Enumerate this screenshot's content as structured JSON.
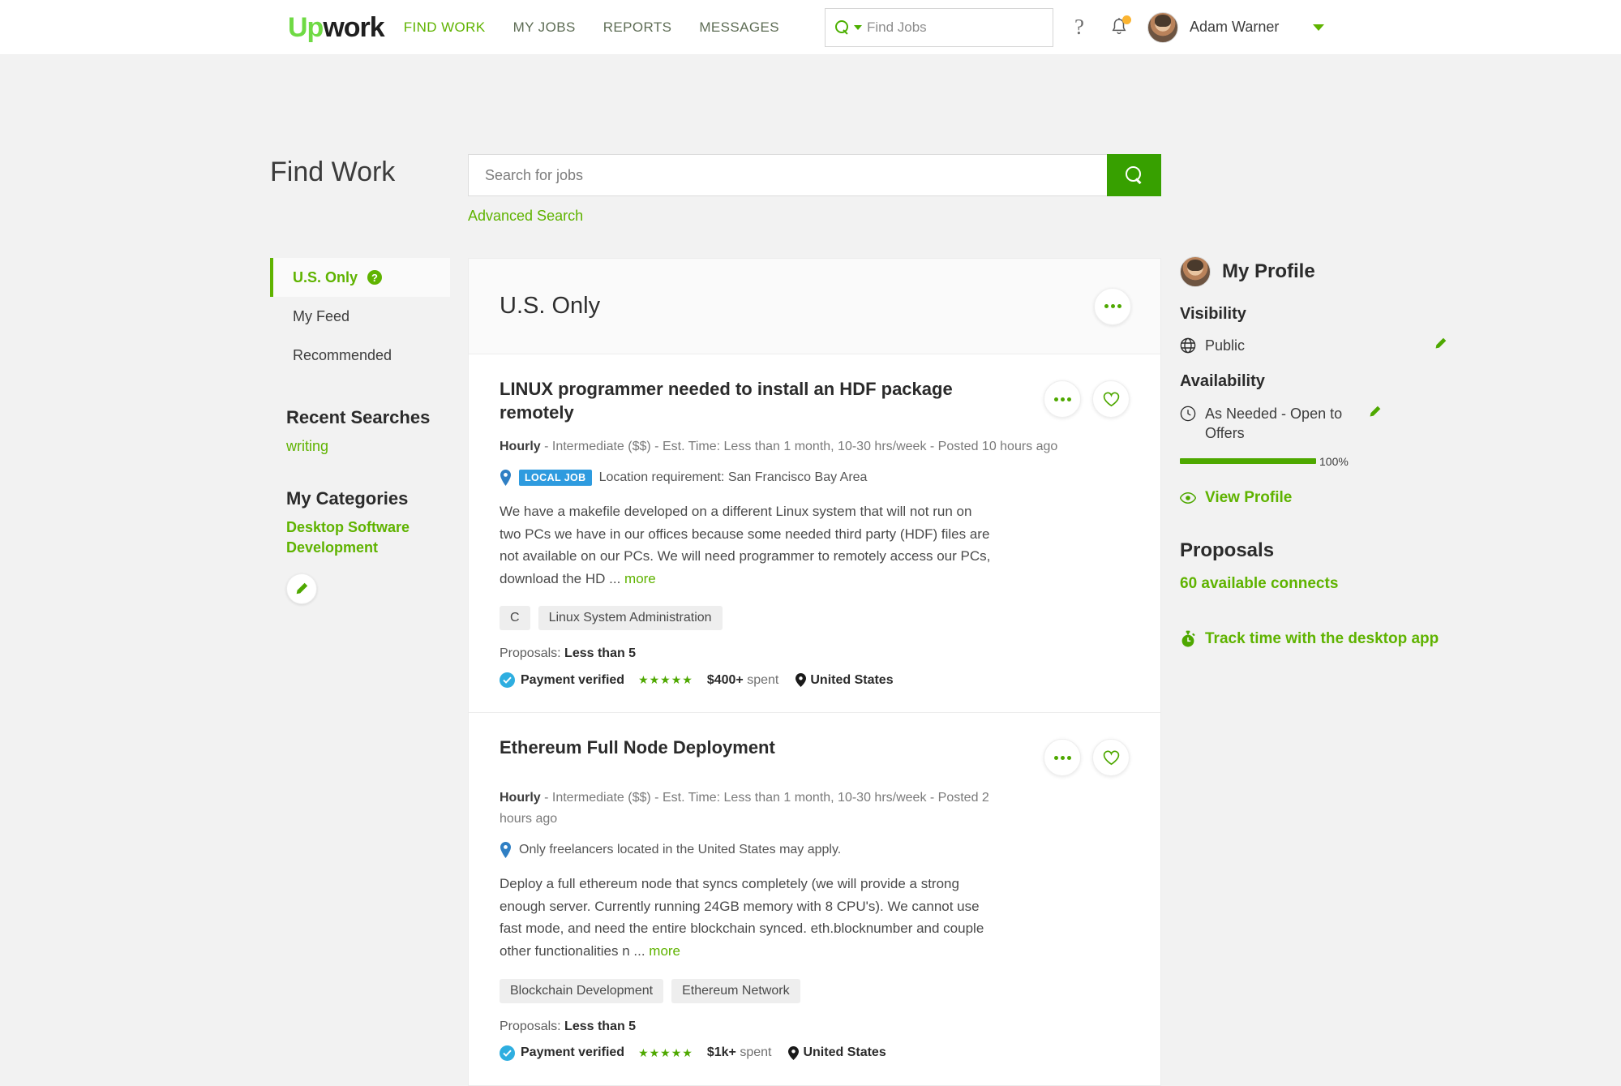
{
  "brand": {
    "logo_up": "Up",
    "logo_work": "work",
    "green": "#5fb300",
    "dark_green": "#37a000",
    "blue": "#2e9bdf"
  },
  "topnav": {
    "links": [
      {
        "label": "FIND WORK",
        "active": true
      },
      {
        "label": "MY JOBS",
        "active": false
      },
      {
        "label": "REPORTS",
        "active": false
      },
      {
        "label": "MESSAGES",
        "active": false
      }
    ],
    "search_placeholder": "Find Jobs",
    "help_label": "?",
    "user_name": "Adam Warner"
  },
  "page": {
    "title": "Find Work",
    "search_value": "",
    "search_placeholder": "Search for jobs",
    "advanced_search": "Advanced Search"
  },
  "sidebar": {
    "items": [
      {
        "label": "U.S. Only",
        "active": true,
        "has_help": true
      },
      {
        "label": "My Feed",
        "active": false,
        "has_help": false
      },
      {
        "label": "Recommended",
        "active": false,
        "has_help": false
      }
    ],
    "recent_searches_heading": "Recent Searches",
    "recent_searches": [
      "writing"
    ],
    "categories_heading": "My Categories",
    "categories": [
      "Desktop Software Development"
    ]
  },
  "card": {
    "heading": "U.S. Only",
    "jobs": [
      {
        "title": "LINUX programmer needed to install an HDF package remotely",
        "meta_type": "Hourly",
        "meta_rest": " - Intermediate ($$) - Est. Time: Less than 1 month, 10-30 hrs/week - Posted 10 hours ago",
        "local_badge": "LOCAL JOB",
        "location_text": "Location requirement: San Francisco Bay Area",
        "description": "We have a makefile developed on a different Linux system that will not run on two PCs we have in our offices because some needed third party (HDF) files are not available on our PCs. We will need programmer to remotely access our PCs, download the HD ... ",
        "more_label": "more",
        "tags": [
          "C",
          "Linux System Administration"
        ],
        "proposals_label": "Proposals: ",
        "proposals_value": "Less than 5",
        "payment_verified": "Payment verified",
        "stars": "★★★★★",
        "spent_amount": "$400+",
        "spent_suffix": " spent",
        "country": "United States"
      },
      {
        "title": "Ethereum Full Node Deployment",
        "meta_type": "Hourly",
        "meta_rest": " - Intermediate ($$) - Est. Time: Less than 1 month, 10-30 hrs/week - Posted 2 hours ago",
        "local_badge": "",
        "location_text": "Only freelancers located in the United States may apply.",
        "description": "Deploy a full ethereum node that syncs completely (we will provide a strong enough server. Currently running 24GB memory with 8 CPU's). We cannot use fast mode, and need the entire blockchain synced. eth.blocknumber and couple other functionalities n ... ",
        "more_label": "more",
        "tags": [
          "Blockchain Development",
          "Ethereum Network"
        ],
        "proposals_label": "Proposals: ",
        "proposals_value": "Less than 5",
        "payment_verified": "Payment verified",
        "stars": "★★★★★",
        "spent_amount": "$1k+",
        "spent_suffix": " spent",
        "country": "United States"
      }
    ]
  },
  "profile": {
    "heading": "My Profile",
    "visibility_label": "Visibility",
    "visibility_value": "Public",
    "availability_label": "Availability",
    "availability_value": "As Needed - Open to Offers",
    "completeness_percent": "100%",
    "completeness_value": 100,
    "view_profile": "View Profile",
    "proposals_heading": "Proposals",
    "connects": "60 available connects",
    "track_time": "Track time with the desktop app"
  }
}
